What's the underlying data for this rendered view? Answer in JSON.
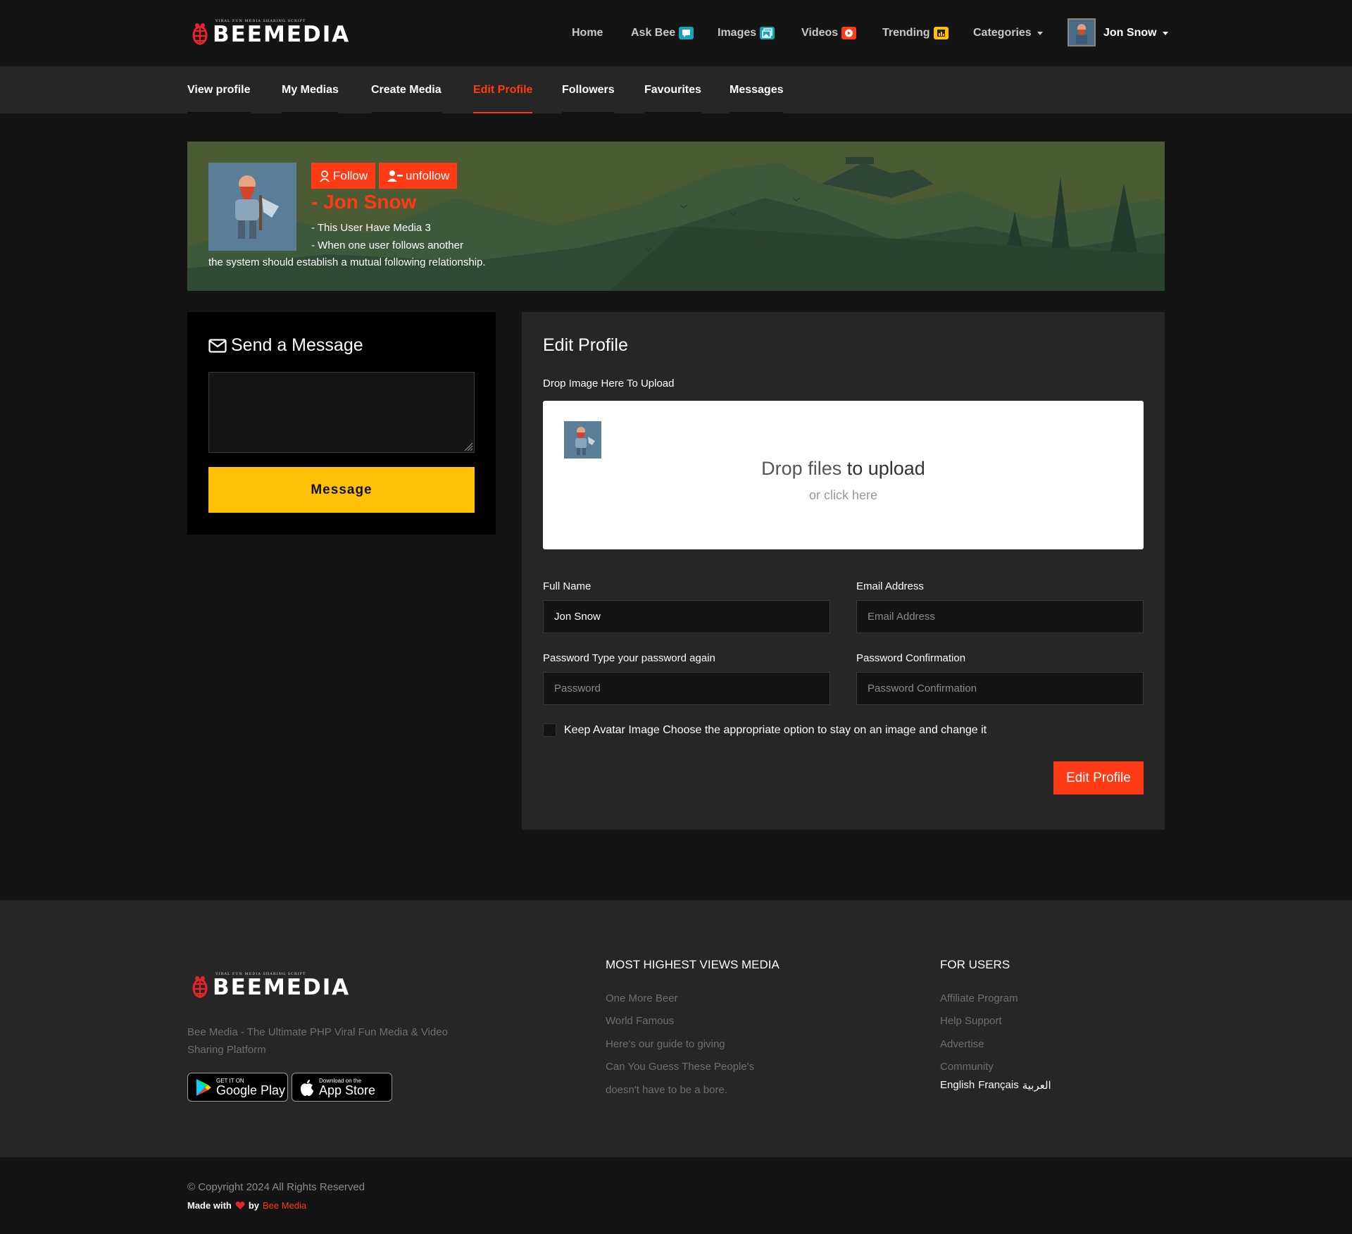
{
  "brand": {
    "name": "BEEMEDIA",
    "tagline": "VIRAL FUN MEDIA SHARING SCRIPT",
    "logo_icon": "bee-logo-icon",
    "accent": "#ff3a14",
    "message_button_color": "#ffc107"
  },
  "topnav": {
    "items": [
      {
        "label": "Home"
      },
      {
        "label": "Ask Bee",
        "icon": "chat-icon",
        "color": "#17a2b8"
      },
      {
        "label": "Images",
        "icon": "images-icon",
        "color": "#17a2b8"
      },
      {
        "label": "Videos",
        "icon": "play-icon",
        "color": "#ff3a14"
      },
      {
        "label": "Trending",
        "icon": "trending-icon",
        "color": "#ffc107"
      },
      {
        "label": "Categories"
      }
    ],
    "user_name": "Jon Snow"
  },
  "subnav": {
    "tabs": [
      {
        "label": "View profile"
      },
      {
        "label": "My Medias"
      },
      {
        "label": "Create Media"
      },
      {
        "label": "Edit Profile",
        "active": true
      },
      {
        "label": "Followers"
      },
      {
        "label": "Favourites"
      },
      {
        "label": "Messages"
      }
    ]
  },
  "profile": {
    "follow_label": "Follow",
    "unfollow_label": "unfollow",
    "name": "- Jon Snow",
    "line1": "- This User Have Media 3",
    "line2": "- When one user follows another",
    "line3": "the system should establish a mutual following relationship."
  },
  "message_card": {
    "title": "Send a Message",
    "button_label": "Message",
    "textarea_value": ""
  },
  "edit_card": {
    "title": "Edit Profile",
    "drop_label": "Drop Image Here To Upload",
    "drop_main_a": "Drop files ",
    "drop_main_b": "to upload",
    "drop_sub": "or click here",
    "full_name_label": "Full Name",
    "full_name_value": "Jon Snow",
    "email_label": "Email Address",
    "email_placeholder": "Email Address",
    "password_label": "Password Type your password again",
    "password_placeholder": "Password",
    "confirm_label": "Password Confirmation",
    "confirm_placeholder": "Password Confirmation",
    "keep_avatar_label": "Keep Avatar Image Choose the appropriate option to stay on an image and change it",
    "keep_avatar_checked": false,
    "submit_label": "Edit Profile"
  },
  "footer": {
    "description": "Bee Media - The Ultimate PHP Viral Fun Media & Video Sharing Platform",
    "google_small": "GET IT ON",
    "google_big": "Google Play",
    "apple_small": "Download on the",
    "apple_big": "App Store",
    "col1_title": "MOST HIGHEST VIEWS MEDIA",
    "col1_links": [
      "One More Beer",
      "World Famous",
      "Here's our guide to giving",
      "Can You Guess These People's",
      "doesn't have to be a bore."
    ],
    "col2_title": "FOR USERS",
    "col2_links": [
      "Affiliate Program",
      "Help Support",
      "Advertise",
      "Community"
    ],
    "languages": [
      "English",
      "Français",
      "العربية"
    ]
  },
  "bottom": {
    "copyright": "© Copyright 2024 All Rights Reserved",
    "made_with": "Made with",
    "by": "by",
    "brand": "Bee Media"
  }
}
